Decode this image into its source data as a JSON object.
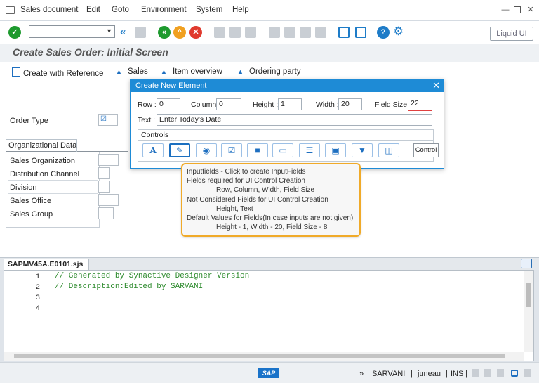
{
  "menu": {
    "items": [
      "Sales document",
      "Edit",
      "Goto",
      "Environment",
      "System",
      "Help"
    ]
  },
  "toolbar": {
    "command_value": "",
    "liquid_ui_label": "Liquid UI"
  },
  "screen": {
    "title": "Create Sales Order: Initial Screen"
  },
  "app_toolbar": {
    "items": [
      "Create with Reference",
      "Sales",
      "Item overview",
      "Ordering party"
    ]
  },
  "form": {
    "order_type_label": "Order Type",
    "org_data_title": "Organizational Data",
    "org_fields": [
      "Sales Organization",
      "Distribution Channel",
      "Division",
      "Sales Office",
      "Sales Group"
    ]
  },
  "dialog": {
    "title": "Create New Element",
    "row_label": "Row :",
    "row_value": "0",
    "column_label": "Column :",
    "column_value": "0",
    "height_label": "Height :",
    "height_value": "1",
    "width_label": "Width :",
    "width_value": "20",
    "fieldsize_label": "Field Size :",
    "fieldsize_value": "22",
    "text_label": "Text :",
    "text_value": "Enter Today's Date",
    "controls_label": "Controls",
    "control_button_label": "Control"
  },
  "tooltip": {
    "lines": [
      "Inputfields - Click to create InputFields",
      "Fields required for UI Control Creation",
      "Row, Column, Width, Field Size",
      "Not Considered Fields for UI Control Creation",
      "Height, Text",
      "Default Values for Fields(In case inputs are not given)",
      "Height - 1, Width - 20, Field Size - 8"
    ]
  },
  "editor": {
    "tab_label": "SAPMV45A.E0101.sjs",
    "line_numbers": [
      "1",
      "2",
      "3",
      "4"
    ],
    "code_lines": [
      "// Generated by Synactive Designer Version",
      "// Description:Edited by SARVANI",
      "",
      ""
    ]
  },
  "status": {
    "user": "SARVANI",
    "server": "juneau",
    "mode": "INS"
  }
}
